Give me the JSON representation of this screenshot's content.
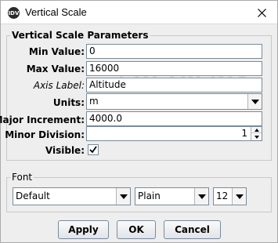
{
  "window": {
    "title": "Vertical Scale",
    "app_icon_text": "IDV"
  },
  "parameters": {
    "legend": "Vertical Scale Parameters",
    "min_value": {
      "label": "Min Value:",
      "value": "0"
    },
    "max_value": {
      "label": "Max Value:",
      "value": "16000"
    },
    "axis_label": {
      "label": "Axis Label:",
      "value": "Altitude"
    },
    "units": {
      "label": "Units:",
      "value": "m"
    },
    "major_increment": {
      "label": "Major Increment:",
      "value": "4000.0"
    },
    "minor_division": {
      "label": "Minor Division:",
      "value": "1"
    },
    "visible": {
      "label": "Visible:",
      "checked": true,
      "mark": "✔"
    }
  },
  "font": {
    "legend": "Font",
    "family": "Default",
    "style": "Plain",
    "size": "12"
  },
  "buttons": {
    "apply": "Apply",
    "ok": "OK",
    "cancel": "Cancel"
  },
  "watermark": "SOFTPEDIA",
  "colors": {
    "field_border": "#7a8a99",
    "window_bg": "#eeeeee"
  }
}
